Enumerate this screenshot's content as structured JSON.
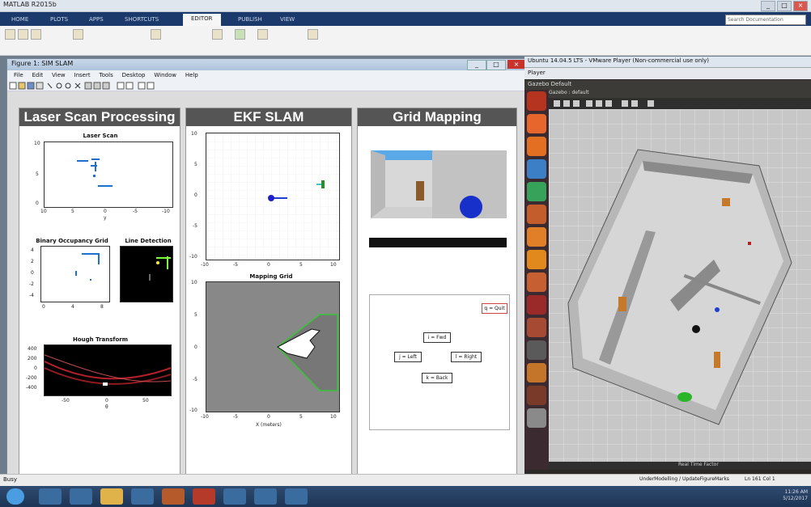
{
  "matlab": {
    "title": "MATLAB R2015b",
    "tabs": [
      "HOME",
      "PLOTS",
      "APPS",
      "SHORTCUTS",
      "EDITOR",
      "PUBLISH",
      "VIEW"
    ],
    "active_tab": "EDITOR",
    "search_placeholder": "Search Documentation",
    "status": "Busy",
    "status_right": "Ln 161   Col 1",
    "status_file": "UnderModelling / UpdateFigureMarks"
  },
  "figure": {
    "title": "Figure 1: SIM SLAM",
    "menu": [
      "File",
      "Edit",
      "View",
      "Insert",
      "Tools",
      "Desktop",
      "Window",
      "Help"
    ],
    "panels": {
      "laser": {
        "header": "Laser Scan Processing"
      },
      "ekf": {
        "header": "EKF SLAM"
      },
      "grid": {
        "header": "Grid Mapping"
      }
    },
    "laser_scan": {
      "title": "Laser Scan",
      "yticks": [
        "10",
        "5",
        "0"
      ],
      "xticks": [
        "10",
        "5",
        "0",
        "-5",
        "-10"
      ],
      "xlabel": "y"
    },
    "binary_grid": {
      "title": "Binary Occupancy Grid",
      "yticks": [
        "4",
        "2",
        "0",
        "-2",
        "-4"
      ],
      "xticks": [
        "0",
        "4",
        "8"
      ]
    },
    "line_detection": {
      "title": "Line Detection"
    },
    "hough": {
      "title": "Hough Transform",
      "yticks": [
        "400",
        "200",
        "0",
        "-200",
        "-400"
      ],
      "xticks": [
        "-50",
        "0",
        "50"
      ],
      "xlabel": "θ"
    },
    "ekf_plot": {
      "yticks": [
        "10",
        "5",
        "0",
        "-5",
        "-10"
      ],
      "xticks": [
        "-10",
        "-5",
        "0",
        "5",
        "10"
      ]
    },
    "mapping_grid": {
      "title": "Mapping Grid",
      "yticks": [
        "10",
        "5",
        "0",
        "-5",
        "-10"
      ],
      "xticks": [
        "-10",
        "-5",
        "0",
        "5",
        "10"
      ],
      "xlabel": "X (meters)"
    },
    "keys": {
      "quit": "q = Quit",
      "fwd": "i = Fwd",
      "left": "j = Left",
      "right": "l = Right",
      "back": "k = Back"
    }
  },
  "vmware": {
    "title": "Ubuntu 14.04.5 LTS - VMware Player (Non-commercial use only)",
    "toolbar": "Player",
    "topbar": "Gazebo  Default",
    "gazebo_title": "Gazebo : default",
    "bottom_text": "Real Time Factor"
  },
  "taskbar": {
    "time": "11:26 AM",
    "date": "5/12/2017"
  },
  "colors": {
    "matlab_tab": "#1b3a6b",
    "panel_header": "#555555",
    "ubuntu_launcher": "#3b2a2f",
    "gazebo_bg": "#c7c7c7"
  }
}
